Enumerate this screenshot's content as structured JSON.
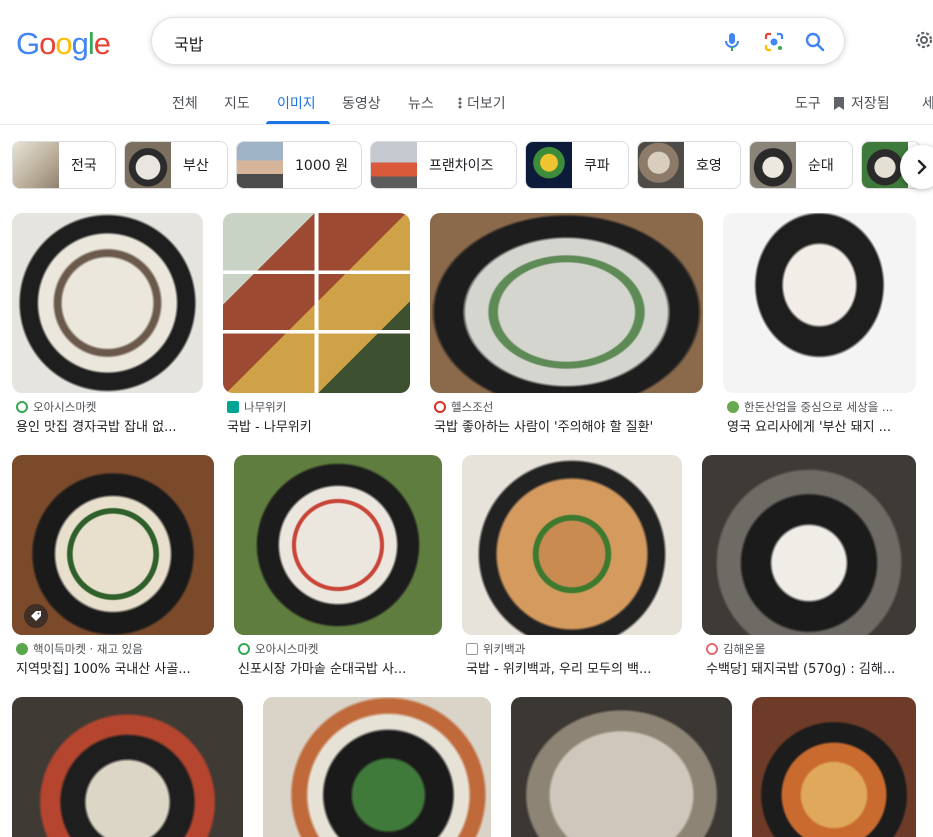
{
  "logo": {
    "letters": [
      "G",
      "o",
      "o",
      "g",
      "l",
      "e"
    ],
    "colors": [
      "#4285F4",
      "#EA4335",
      "#FBBC05",
      "#4285F4",
      "#34A853",
      "#EA4335"
    ]
  },
  "search": {
    "query": "국밥"
  },
  "tabs": [
    {
      "label": "전체",
      "active": false
    },
    {
      "label": "지도",
      "active": false
    },
    {
      "label": "이미지",
      "active": true
    },
    {
      "label": "동영상",
      "active": false
    },
    {
      "label": "뉴스",
      "active": false
    },
    {
      "label": "더보기",
      "active": false
    }
  ],
  "tools": {
    "tools_label": "도구",
    "saved_label": "저장됨",
    "safe_label": "세"
  },
  "chips": [
    {
      "label": "전국"
    },
    {
      "label": "부산"
    },
    {
      "label": "1000 원"
    },
    {
      "label": "프랜차이즈"
    },
    {
      "label": "쿠파"
    },
    {
      "label": "호영"
    },
    {
      "label": "순대"
    }
  ],
  "results": [
    {
      "source": "오아시스마켓",
      "title": "용인 맛집 경자국밥 잡내 없..."
    },
    {
      "source": "나무위키",
      "title": "국밥 - 나무위키"
    },
    {
      "source": "헬스조선",
      "title": "국밥 좋아하는 사람이 '주의해야 할 질환'"
    },
    {
      "source": "한돈산업을 중심으로 세상을 ...",
      "title": "영국 요리사에게 '부산 돼지 ..."
    },
    {
      "source": "핵이득마켓 · 재고 있음",
      "title": "지역맛집] 100% 국내산 사골..."
    },
    {
      "source": "오아시스마켓",
      "title": "신포시장 가마솥 순대국밥 사..."
    },
    {
      "source": "위키백과",
      "title": "국밥 - 위키백과, 우리 모두의 백..."
    },
    {
      "source": "김해온몰",
      "title": "수백당] 돼지국밥 (570g) : 김해..."
    }
  ]
}
